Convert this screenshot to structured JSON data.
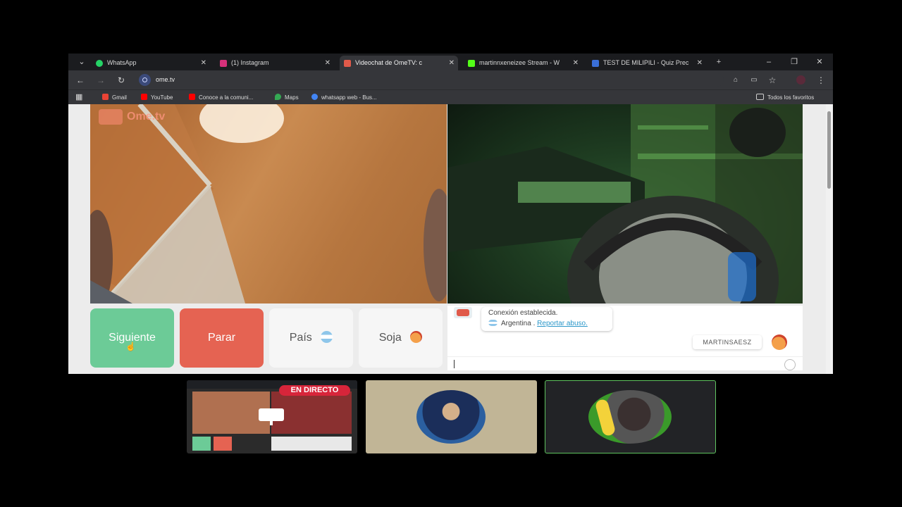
{
  "browser": {
    "tabs": [
      {
        "label": "WhatsApp",
        "icon": "whatsapp-icon",
        "color": "#25d366"
      },
      {
        "label": "(1) Instagram",
        "icon": "instagram-icon",
        "color": "#d6317a"
      },
      {
        "label": "Videochat de OmeTV: c",
        "icon": "ometv-icon",
        "color": "#e05a4a",
        "active": true
      },
      {
        "label": "martinnxeneizee Stream - W",
        "icon": "kick-icon",
        "color": "#53fc18"
      },
      {
        "label": "TEST DE MILIPILI - Quiz Prec",
        "icon": "quiz-icon",
        "color": "#3a6fd8"
      }
    ],
    "url": "ome.tv",
    "bookmarks": [
      {
        "label": "Gmail",
        "icon": "gmail-icon",
        "color": "#ea4335"
      },
      {
        "label": "YouTube",
        "icon": "youtube-icon",
        "color": "#ff0000"
      },
      {
        "label": "Conoce a la comuni...",
        "icon": "youtube-icon",
        "color": "#ff0000"
      },
      {
        "label": "Maps",
        "icon": "maps-icon",
        "color": "#34a853"
      },
      {
        "label": "whatsapp web - Bus...",
        "icon": "google-icon",
        "color": "#4285f4"
      }
    ],
    "all_bookmarks": "Todos los favoritos"
  },
  "page": {
    "logo_text": "Ome.tv",
    "buttons": {
      "next": "Siguiente",
      "stop": "Parar",
      "country": "País",
      "sex": "Soja"
    },
    "chat": {
      "status": "Conexión establecida.",
      "country": "Argentina .",
      "report": "Reportar abuso.",
      "username": "MARTINSAESZ"
    }
  },
  "thumbnails": {
    "live_badge": "EN DIRECTO"
  }
}
